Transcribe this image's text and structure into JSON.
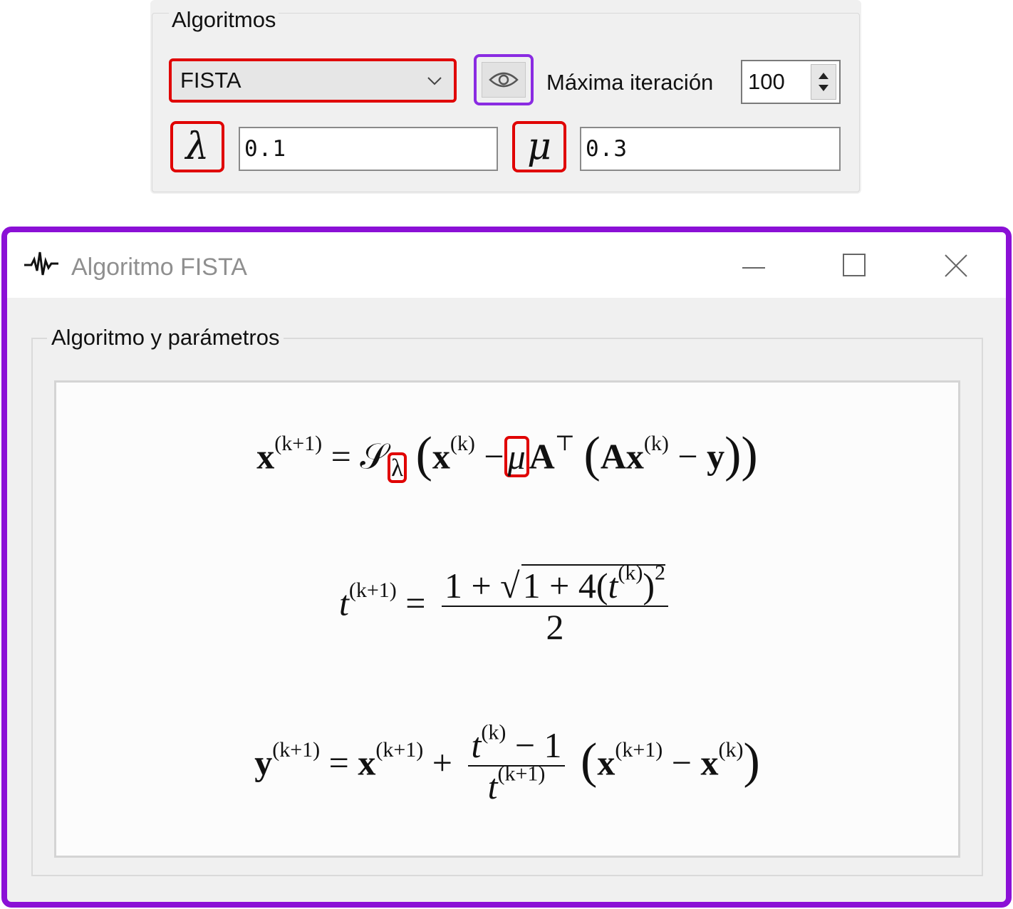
{
  "panel": {
    "title": "Algoritmos",
    "algorithm_select": "FISTA",
    "max_iter_label": "Máxima iteración",
    "max_iter_value": "100",
    "lambda_symbol": "λ",
    "lambda_value": "0.1",
    "mu_symbol": "μ",
    "mu_value": "0.3"
  },
  "window": {
    "title": "Algoritmo FISTA",
    "group_title": "Algoritmo y parámetros"
  },
  "formulas": {
    "x_lhs": "x",
    "k1": "(k+1)",
    "k": "(k)",
    "shrink": "𝒮",
    "lambda": "λ",
    "mu": "μ",
    "A": "A",
    "top": "⊤",
    "y": "y",
    "t": "t",
    "one": "1",
    "four": "4",
    "two": "2",
    "sq": "2",
    "minus": "−",
    "plus": "+",
    "eq": "="
  },
  "colors": {
    "highlight_red": "#e00000",
    "highlight_purple": "#8a2be2",
    "window_border": "#8b10d6"
  }
}
